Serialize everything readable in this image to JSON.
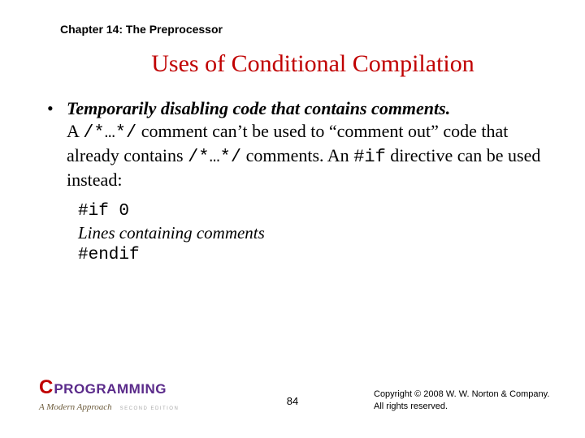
{
  "chapter": "Chapter 14: The Preprocessor",
  "title": "Uses of Conditional Compilation",
  "bullet": {
    "heading": "Temporarily disabling code that contains comments.",
    "line2_a": "A ",
    "line2_code": "/*…*/",
    "line2_b": " comment can’t be used to “comment out” code that already contains ",
    "line2_code2": "/*…*/",
    "line2_c": " comments. An ",
    "line2_code3": "#if",
    "line2_d": " directive can be used instead:"
  },
  "code": {
    "l1": "#if 0",
    "l2": "Lines containing comments",
    "l3": "#endif"
  },
  "footer": {
    "logo_c": "C",
    "logo_prog": "PROGRAMMING",
    "logo_sub": "A Modern Approach",
    "logo_ed": "SECOND EDITION",
    "page": "84",
    "copy1": "Copyright © 2008 W. W. Norton & Company.",
    "copy2": "All rights reserved."
  }
}
